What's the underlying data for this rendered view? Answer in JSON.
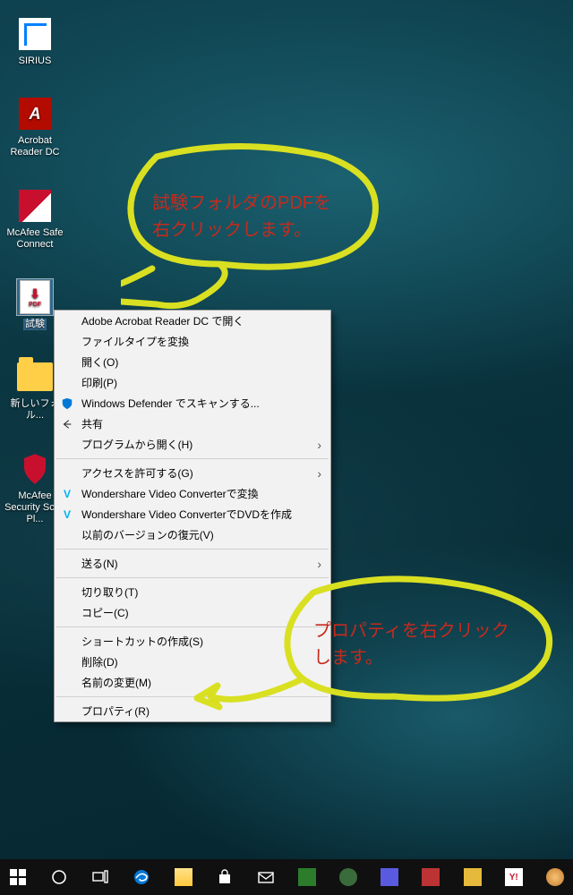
{
  "desktop": {
    "icons": [
      {
        "name": "sirius",
        "label": "SIRIUS"
      },
      {
        "name": "acrobat",
        "label": "Acrobat Reader DC"
      },
      {
        "name": "mcafee-safe",
        "label": "McAfee Safe Connect"
      },
      {
        "name": "shiken-pdf",
        "label": "試験"
      },
      {
        "name": "new-folder",
        "label": "新しいフォル..."
      },
      {
        "name": "mcafee-scan",
        "label": "McAfee Security Scan Pl..."
      }
    ]
  },
  "context_menu": {
    "items": [
      {
        "label": "Adobe Acrobat Reader DC で開く",
        "icon": null,
        "sub": false
      },
      {
        "label": "ファイルタイプを変換",
        "icon": null,
        "sub": false
      },
      {
        "label": "開く(O)",
        "icon": null,
        "sub": false
      },
      {
        "label": "印刷(P)",
        "icon": null,
        "sub": false
      },
      {
        "label": "Windows Defender でスキャンする...",
        "icon": "defender",
        "sub": false
      },
      {
        "label": "共有",
        "icon": "share",
        "sub": false
      },
      {
        "label": "プログラムから開く(H)",
        "icon": null,
        "sub": true
      },
      "---",
      {
        "label": "アクセスを許可する(G)",
        "icon": null,
        "sub": true
      },
      {
        "label": "Wondershare Video Converterで変換",
        "icon": "w",
        "sub": false
      },
      {
        "label": "Wondershare Video ConverterでDVDを作成",
        "icon": "w",
        "sub": false
      },
      {
        "label": "以前のバージョンの復元(V)",
        "icon": null,
        "sub": false
      },
      "---",
      {
        "label": "送る(N)",
        "icon": null,
        "sub": true
      },
      "---",
      {
        "label": "切り取り(T)",
        "icon": null,
        "sub": false
      },
      {
        "label": "コピー(C)",
        "icon": null,
        "sub": false
      },
      "---",
      {
        "label": "ショートカットの作成(S)",
        "icon": null,
        "sub": false
      },
      {
        "label": "削除(D)",
        "icon": null,
        "sub": false
      },
      {
        "label": "名前の変更(M)",
        "icon": null,
        "sub": false
      },
      "---",
      {
        "label": "プロパティ(R)",
        "icon": null,
        "sub": false
      }
    ]
  },
  "annotations": {
    "top_line1": "試験フォルダのPDFを",
    "top_line2": "右クリックします。",
    "bottom_line1": "プロパティを右クリック",
    "bottom_line2": "します。"
  },
  "taskbar": {
    "items": [
      "start",
      "cortana",
      "task-view",
      "edge",
      "explorer",
      "store",
      "mail",
      "app-a",
      "app-b",
      "app-c",
      "app-d",
      "app-e",
      "app-f",
      "app-g",
      "app-h",
      "app-i"
    ]
  }
}
